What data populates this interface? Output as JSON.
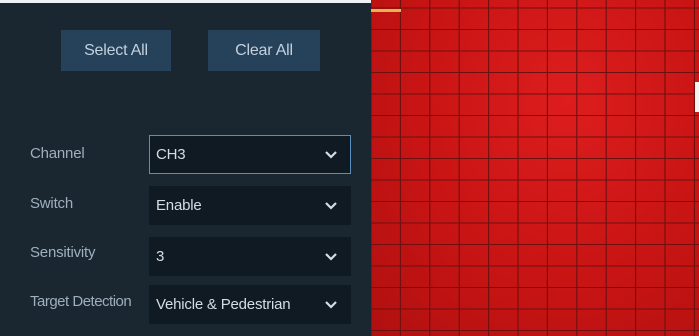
{
  "buttons": {
    "select_all": "Select All",
    "clear_all": "Clear All"
  },
  "settings": [
    {
      "key": "channel",
      "label": "Channel",
      "value": "CH3"
    },
    {
      "key": "switch",
      "label": "Switch",
      "value": "Enable"
    },
    {
      "key": "sensitivity",
      "label": "Sensitivity",
      "value": "3"
    },
    {
      "key": "target_detection",
      "label": "Target Detection",
      "value": "Vehicle & Pedestrian"
    }
  ],
  "grid": {
    "fill_color": "#c81414",
    "line_color": "#6e1010",
    "all_cells_selected": true
  },
  "colors": {
    "panel_bg": "#1a2630",
    "button_bg": "#26415a",
    "select_bg": "#101a23",
    "focus_border": "#5b8fbf",
    "marker": "#e6b34a"
  }
}
